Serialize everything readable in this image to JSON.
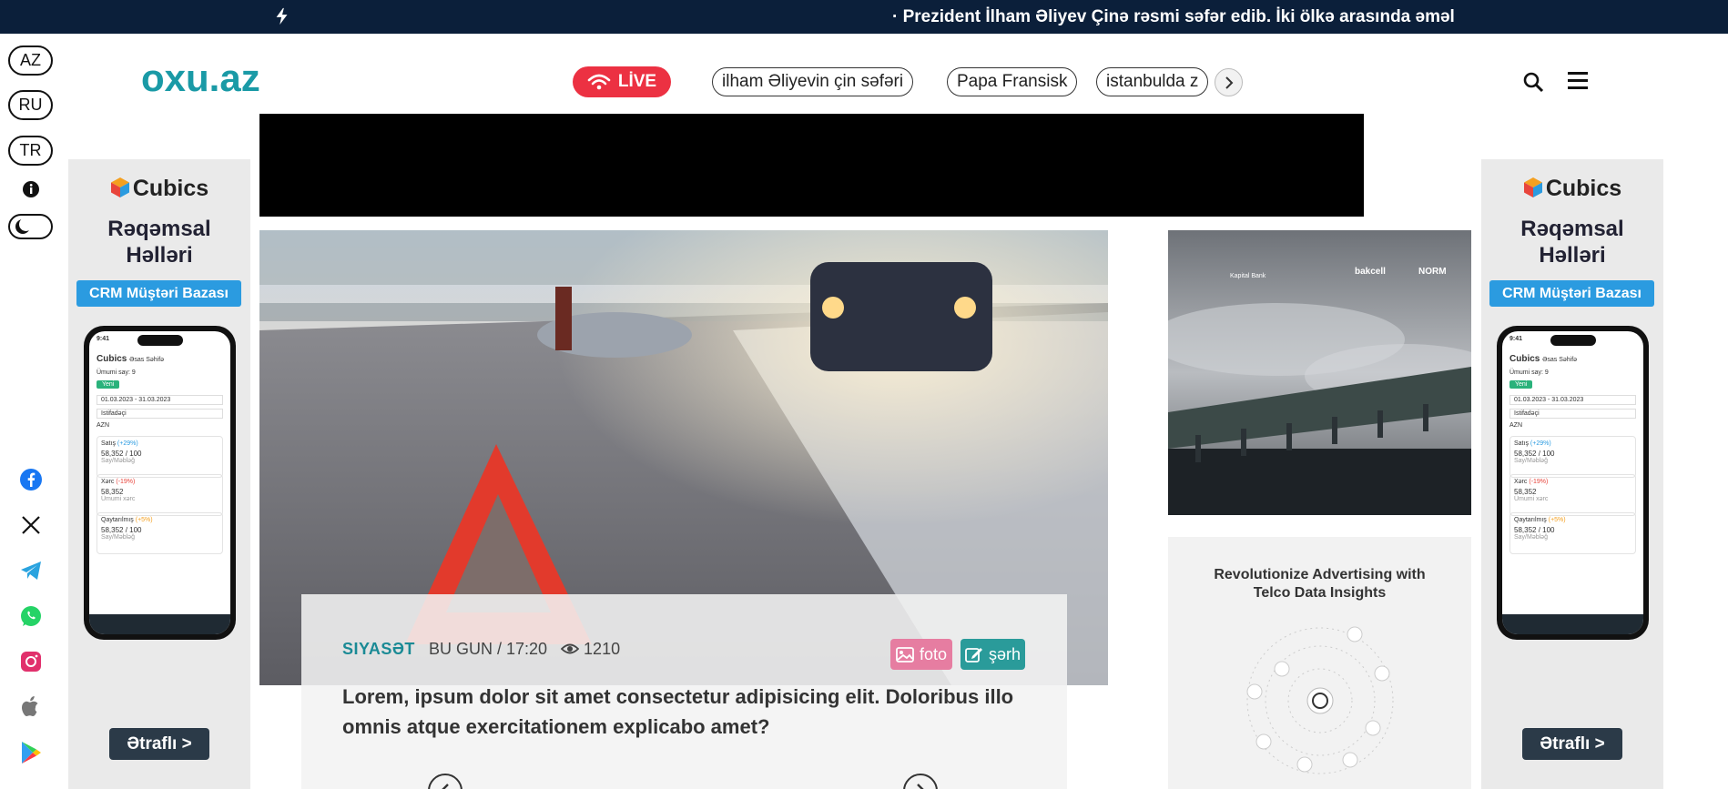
{
  "ticker": {
    "headline": "· Prezident İlham Əliyev Çinə rəsmi səfər edib. İki ölkə arasında əməl"
  },
  "languages": [
    "AZ",
    "RU",
    "TR"
  ],
  "header": {
    "logo": "oxu.az",
    "live_label": "LİVE",
    "tags": [
      "ilham Əliyevin çin səfəri",
      "Papa Fransisk",
      "istanbulda z"
    ]
  },
  "side_ad": {
    "brand": "Cubics",
    "title_line1": "Rəqəmsal",
    "title_line2": "Həlləri",
    "badge": "CRM Müştəri Bazası",
    "cta": "Ətraflı >",
    "phone": {
      "time": "9:41",
      "app_name": "Cubics",
      "page": "Əsas Səhifə",
      "total": "Ümumi say: 9",
      "new_btn": "Yeni",
      "date_range": "01.03.2023 - 31.03.2023",
      "filter": "Istifadəçi",
      "currency": "AZN",
      "cards": [
        {
          "label": "Satış",
          "change": "(+29%)",
          "value": "58,352 / 100",
          "sub": "Say/Məbləğ"
        },
        {
          "label": "Xərc",
          "change": "(-19%)",
          "value": "58,352",
          "sub": "Ümumi xərc"
        },
        {
          "label": "Qaytarılmış",
          "change": "(+5%)",
          "value": "58,352 / 100",
          "sub": "Say/Məbləğ"
        }
      ]
    }
  },
  "article": {
    "category": "SIYASƏT",
    "time": "BU GUN / 17:20",
    "views": "1210",
    "foto_label": "foto",
    "serh_label": "şərh",
    "headline": "Lorem, ipsum dolor sit amet consectetur adipisicing elit. Doloribus illo omnis atque exercitationem explicabo amet?"
  },
  "right_ad": {
    "title": "Revolutionize Advertising with Telco Data Insights",
    "logos": [
      "bakcell",
      "NORM",
      "Kapital Bank"
    ]
  },
  "colors": {
    "ticker_bg": "#0b1f3a",
    "brand_teal": "#1a9aa6",
    "live_red": "#ec3142",
    "foto_pink": "#e67da1",
    "serh_teal": "#2a9b9a",
    "ad_blue": "#2b9be0"
  }
}
